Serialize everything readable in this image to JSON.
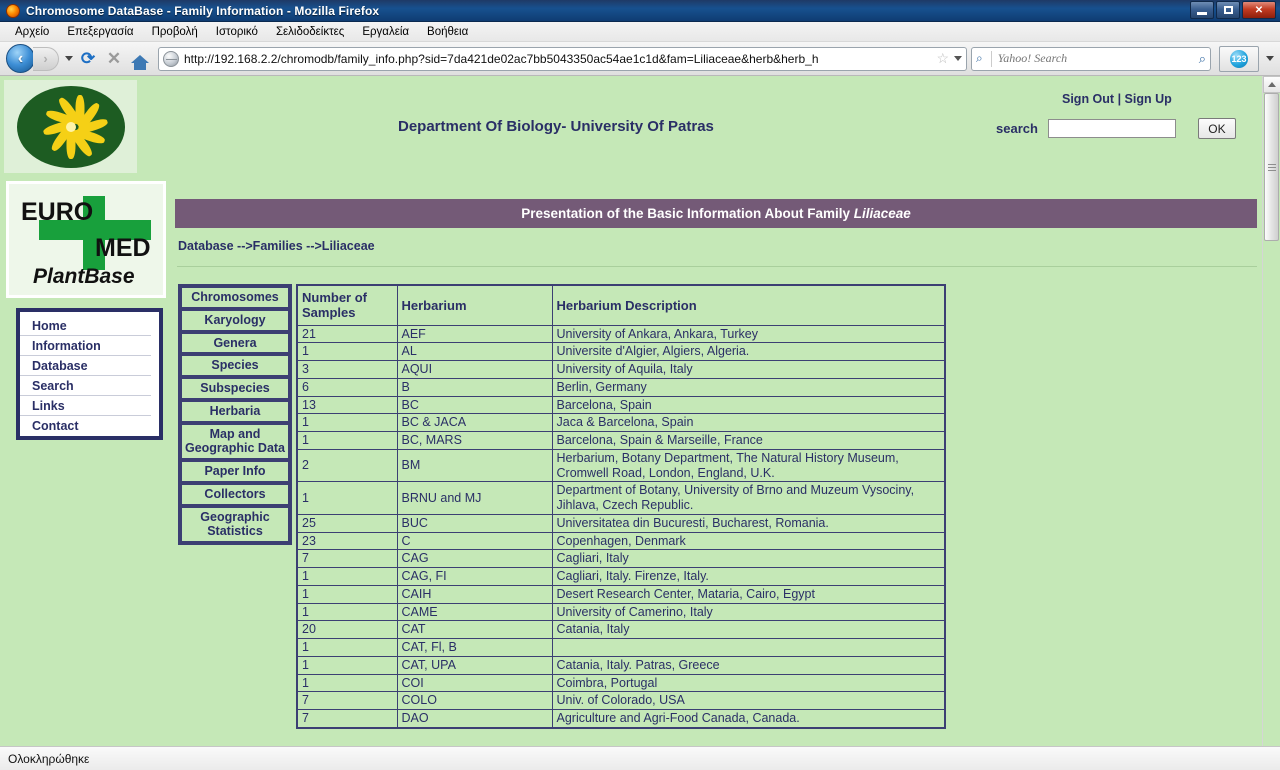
{
  "window": {
    "title": "Chromosome DataBase - Family Information - Mozilla Firefox",
    "minimize_label": "–",
    "maximize_label": "❐",
    "close_label": "✕"
  },
  "menubar": {
    "items": [
      {
        "label": "Αρχείο"
      },
      {
        "label": "Επεξεργασία"
      },
      {
        "label": "Προβολή"
      },
      {
        "label": "Ιστορικό"
      },
      {
        "label": "Σελιδοδείκτες"
      },
      {
        "label": "Εργαλεία"
      },
      {
        "label": "Βοήθεια"
      }
    ]
  },
  "toolbar": {
    "back_glyph": "‹",
    "forward_glyph": "›",
    "reload_glyph": "⟳",
    "stop_glyph": "✕",
    "url": "http://192.168.2.2/chromodb/family_info.php?sid=7da421de02ac7bb5043350ac54ae1c1d&fam=Liliaceae&herb&herb_h",
    "star_glyph": "☆",
    "search_placeholder": "Yahoo! Search",
    "search_value": "",
    "search_icon_glyph": "⌕",
    "magnifier_glyph": "⌕",
    "skype_label": "123"
  },
  "page": {
    "dept_title": "Department Of Biology- University Of Patras",
    "sign_out": "Sign Out",
    "sign_divider": "|",
    "sign_up": "Sign Up",
    "search_label": "search",
    "search_value": "",
    "ok_button": "OK",
    "banner_prefix": "Presentation of the Basic Information About Family ",
    "banner_species": "Liliaceae",
    "breadcrumb": "Database -->Families -->Liliaceae",
    "logo": {
      "euro": "EURO",
      "med": "MED",
      "plantbase": "PlantBase"
    },
    "sidenav": [
      {
        "label": "Home"
      },
      {
        "label": "Information"
      },
      {
        "label": "Database"
      },
      {
        "label": "Search"
      },
      {
        "label": "Links"
      },
      {
        "label": "Contact"
      }
    ],
    "categories": [
      {
        "label": "Chromosomes"
      },
      {
        "label": "Karyology"
      },
      {
        "label": "Genera"
      },
      {
        "label": "Species"
      },
      {
        "label": "Subspecies"
      },
      {
        "label": "Herbaria"
      },
      {
        "label": "Map and Geographic Data"
      },
      {
        "label": "Paper Info"
      },
      {
        "label": "Collectors"
      },
      {
        "label": "Geographic Statistics"
      }
    ],
    "table": {
      "headers": [
        "Number of Samples",
        "Herbarium",
        "Herbarium Description"
      ],
      "rows": [
        [
          "21",
          "AEF",
          "University of Ankara, Ankara, Turkey"
        ],
        [
          "1",
          "AL",
          "Universite d'Algier, Algiers, Algeria."
        ],
        [
          "3",
          "AQUI",
          "University of Aquila, Italy"
        ],
        [
          "6",
          "B",
          "Berlin, Germany"
        ],
        [
          "13",
          "BC",
          "Barcelona, Spain"
        ],
        [
          "1",
          "BC & JACA",
          "Jaca & Barcelona, Spain"
        ],
        [
          "1",
          "BC, MARS",
          "Barcelona, Spain & Marseille, France"
        ],
        [
          "2",
          "BM",
          "Herbarium, Botany Department, The Natural History Museum, Cromwell Road, London, England, U.K."
        ],
        [
          "1",
          "BRNU and MJ",
          "Department of Botany, University of Brno and Muzeum Vysociny, Jihlava, Czech Republic."
        ],
        [
          "25",
          "BUC",
          "Universitatea din Bucuresti, Bucharest, Romania."
        ],
        [
          "23",
          "C",
          "Copenhagen, Denmark"
        ],
        [
          "7",
          "CAG",
          "Cagliari, Italy"
        ],
        [
          "1",
          "CAG, FI",
          "Cagliari, Italy. Firenze, Italy."
        ],
        [
          "1",
          "CAIH",
          "Desert Research Center, Mataria, Cairo, Egypt"
        ],
        [
          "1",
          "CAME",
          "University of Camerino, Italy"
        ],
        [
          "20",
          "CAT",
          "Catania, Italy"
        ],
        [
          "1",
          "CAT, Fl, B",
          ""
        ],
        [
          "1",
          "CAT, UPA",
          "Catania, Italy. Patras, Greece"
        ],
        [
          "1",
          "COI",
          "Coimbra, Portugal"
        ],
        [
          "7",
          "COLO",
          "Univ. of Colorado, USA"
        ],
        [
          "7",
          "DAO",
          "Agriculture and Agri-Food Canada, Canada."
        ]
      ]
    }
  },
  "statusbar": {
    "text": "Ολοκληρώθηκε"
  },
  "colors": {
    "page_green": "#c5e8b7",
    "banner_purple": "#745a77",
    "navy_text": "#2a2f66",
    "border_navy": "#3c3f73",
    "logo_green": "#18a03c"
  }
}
